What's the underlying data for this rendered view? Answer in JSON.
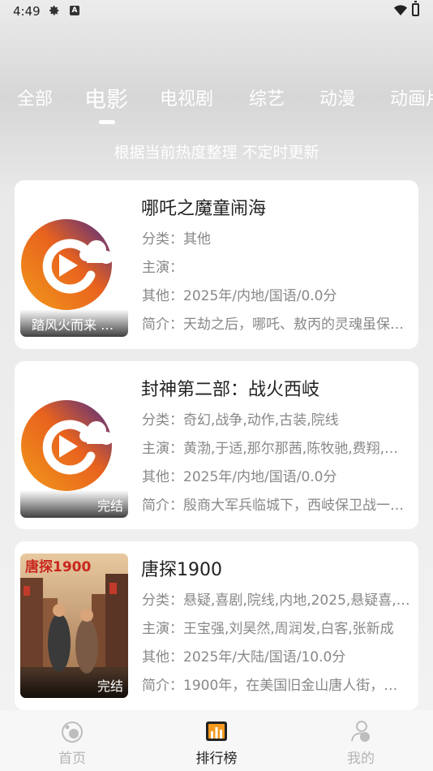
{
  "status": {
    "time": "4:49",
    "a_badge": "A"
  },
  "tabs": [
    {
      "label": "全部"
    },
    {
      "label": "电影"
    },
    {
      "label": "电视剧"
    },
    {
      "label": "综艺"
    },
    {
      "label": "动漫"
    },
    {
      "label": "动画片"
    }
  ],
  "active_tab": "电影",
  "subtitle": "根据当前热度整理 不定时更新",
  "items": [
    {
      "title": "哪吒之魔童闹海",
      "badge": "踏风火而来 赴…",
      "category_label": "分类：",
      "category": "其他",
      "cast_label": "主演：",
      "cast": "",
      "other_label": "其他：",
      "other": "2025年/内地/国语/0.0分",
      "intro_label": "简介：",
      "intro": "天劫之后，哪吒、敖丙的灵魂虽保…"
    },
    {
      "title": "封神第二部：战火西岐",
      "badge": "完结",
      "category_label": "分类：",
      "category": "奇幻,战争,动作,古装,院线",
      "cast_label": "主演：",
      "cast": "黄渤,于适,那尔那茜,陈牧驰,费翔,…",
      "other_label": "其他：",
      "other": "2025年/内地/国语/0.0分",
      "intro_label": "简介：",
      "intro": "殷商大军兵临城下，西岐保卫战一…"
    },
    {
      "title": "唐探1900",
      "badge": "完结",
      "poster_title": "唐探1900",
      "category_label": "分类：",
      "category": "悬疑,喜剧,院线,内地,2025,悬疑喜,…",
      "cast_label": "主演：",
      "cast": "王宝强,刘昊然,周润发,白客,张新成",
      "other_label": "其他：",
      "other": "2025年/大陆/国语/10.0分",
      "intro_label": "简介：",
      "intro": "1900年，在美国旧金山唐人街，…"
    }
  ],
  "nav": [
    {
      "label": "首页",
      "icon": "home-icon"
    },
    {
      "label": "排行榜",
      "icon": "ranking-icon"
    },
    {
      "label": "我的",
      "icon": "profile-icon"
    }
  ],
  "colors": {
    "accent_orange": "#F07A1A",
    "accent_purple": "#5B2A86"
  }
}
